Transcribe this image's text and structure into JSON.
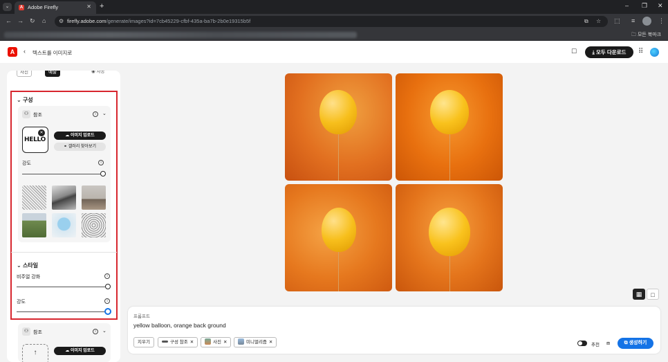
{
  "browser": {
    "tab_title": "Adobe Firefly",
    "url_host": "firefly.adobe.com",
    "url_path": "/generate/images?id=7cb45229-cfbf-435a-ba7b-2b0e19315b5f",
    "bookmarks_folder": "모든 북마크"
  },
  "header": {
    "breadcrumb": "텍스트를 이미지로",
    "download_all": "모두 다운로드"
  },
  "panel": {
    "top_tabs": [
      "사진",
      "예술",
      "자동"
    ],
    "composition_title": "구성",
    "reference_label": "참조",
    "hello_text": "HELLO",
    "upload_image": "이미지 업로드",
    "browse_gallery": "갤러리 찾아보기",
    "strength_label": "강도",
    "style_title": "스타일",
    "visual_intensity": "비주얼 강화",
    "strength_label_2": "강도",
    "reference_label_2": "참조",
    "upload_image_2": "이미지 업로드",
    "composition_strength": 1.0,
    "visual_intensity_value": 1.0,
    "style_strength": 1.0
  },
  "prompt": {
    "label": "프롬프트",
    "text": "yellow balloon, orange back ground",
    "clear": "지우기",
    "chips": [
      "구성 참조",
      "사진",
      "미니멀리즘"
    ],
    "recommend": "추천",
    "generate": "생성하기"
  },
  "colors": {
    "accent": "#1473e6",
    "highlight": "#d7262e",
    "adobe_red": "#eb1000"
  }
}
